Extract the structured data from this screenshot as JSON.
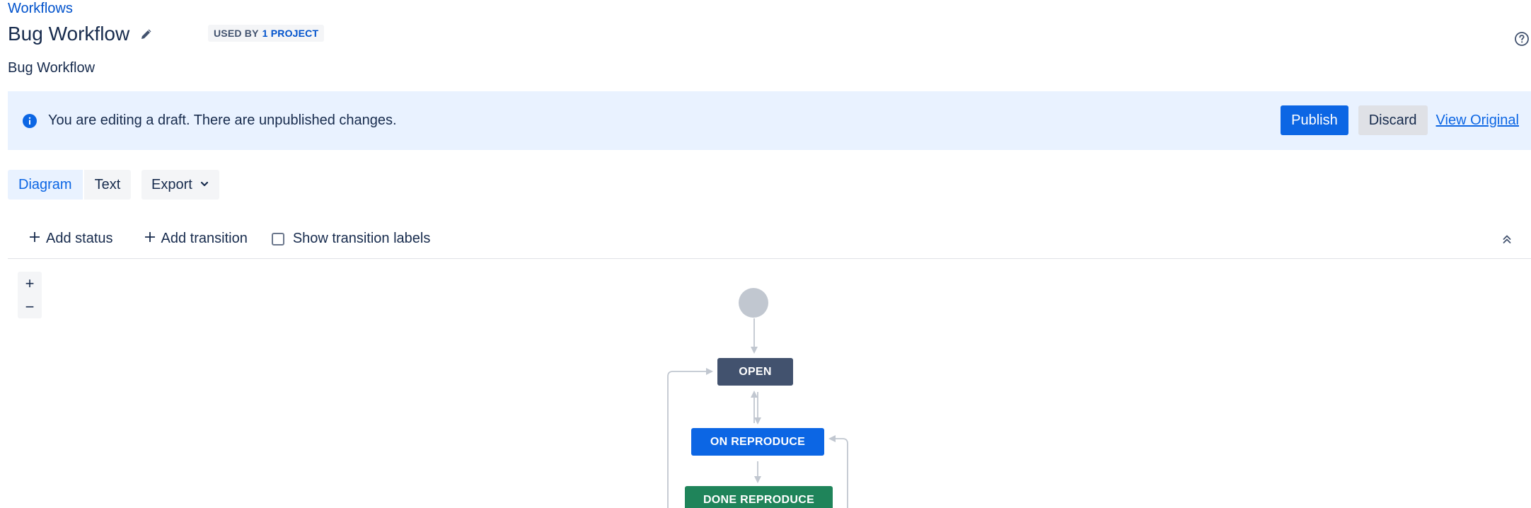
{
  "breadcrumb": {
    "label": "Workflows"
  },
  "header": {
    "title": "Bug Workflow",
    "used_by_label": "USED BY",
    "used_by_link": "1 PROJECT",
    "description": "Bug Workflow"
  },
  "banner": {
    "message": "You are editing a draft. There are unpublished changes.",
    "publish_label": "Publish",
    "discard_label": "Discard",
    "view_original_label": "View Original"
  },
  "view_tabs": [
    {
      "label": "Diagram",
      "active": true
    },
    {
      "label": "Text",
      "active": false
    }
  ],
  "export": {
    "label": "Export"
  },
  "toolbar": {
    "add_status_label": "Add status",
    "add_transition_label": "Add transition",
    "show_labels_label": "Show transition labels",
    "show_labels_checked": false
  },
  "zoom": {
    "in": "+",
    "out": "−"
  },
  "diagram": {
    "statuses": [
      {
        "name": "OPEN",
        "color": "#42526e"
      },
      {
        "name": "ON REPRODUCE",
        "color": "#0c66e4"
      },
      {
        "name": "DONE REPRODUCE",
        "color": "#1f845a"
      }
    ]
  },
  "colors": {
    "accent": "#0c66e4",
    "banner_bg": "#e9f2ff",
    "edge": "#c1c7d0"
  },
  "icons": [
    "edit-icon",
    "help-icon",
    "info-icon",
    "chevron-down-icon",
    "plus-icon",
    "collapse-icon"
  ]
}
